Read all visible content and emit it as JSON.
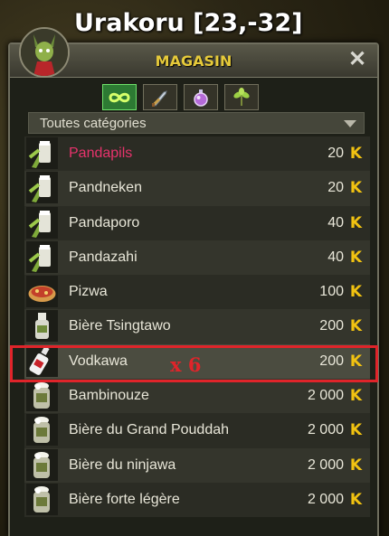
{
  "header": {
    "map_title": "Urakoru [23,-32]"
  },
  "window": {
    "title": "MAGASIN",
    "close_symbol": "✕"
  },
  "tabs": [
    {
      "name": "tab-all",
      "icon": "infinity-icon",
      "active": true
    },
    {
      "name": "tab-weapons",
      "icon": "sword-icon",
      "active": false
    },
    {
      "name": "tab-consumables",
      "icon": "potion-icon",
      "active": false
    },
    {
      "name": "tab-resources",
      "icon": "leaf-icon",
      "active": false
    }
  ],
  "filter": {
    "selected": "Toutes catégories"
  },
  "currency_symbol": "K",
  "items": [
    {
      "name": "Pandapils",
      "price": "20",
      "icon": "bamboo-beer-icon",
      "highlight_name": true
    },
    {
      "name": "Pandneken",
      "price": "20",
      "icon": "bamboo-beer-icon"
    },
    {
      "name": "Pandaporo",
      "price": "40",
      "icon": "bamboo-beer-icon"
    },
    {
      "name": "Pandazahi",
      "price": "40",
      "icon": "bamboo-beer-icon"
    },
    {
      "name": "Pizwa",
      "price": "100",
      "icon": "pizza-icon"
    },
    {
      "name": "Bière Tsingtawo",
      "price": "200",
      "icon": "beer-bottle-icon"
    },
    {
      "name": "Vodkawa",
      "price": "200",
      "icon": "vodka-bottle-icon",
      "selected": true
    },
    {
      "name": "Bambinouze",
      "price": "2 000",
      "icon": "jug-icon"
    },
    {
      "name": "Bière du Grand Pouddah",
      "price": "2 000",
      "icon": "jug-icon"
    },
    {
      "name": "Bière du ninjawa",
      "price": "2 000",
      "icon": "jug-icon"
    },
    {
      "name": "Bière forte légère",
      "price": "2 000",
      "icon": "jug-icon"
    }
  ],
  "annotation": {
    "text": "x 6",
    "color": "#e0242a"
  }
}
